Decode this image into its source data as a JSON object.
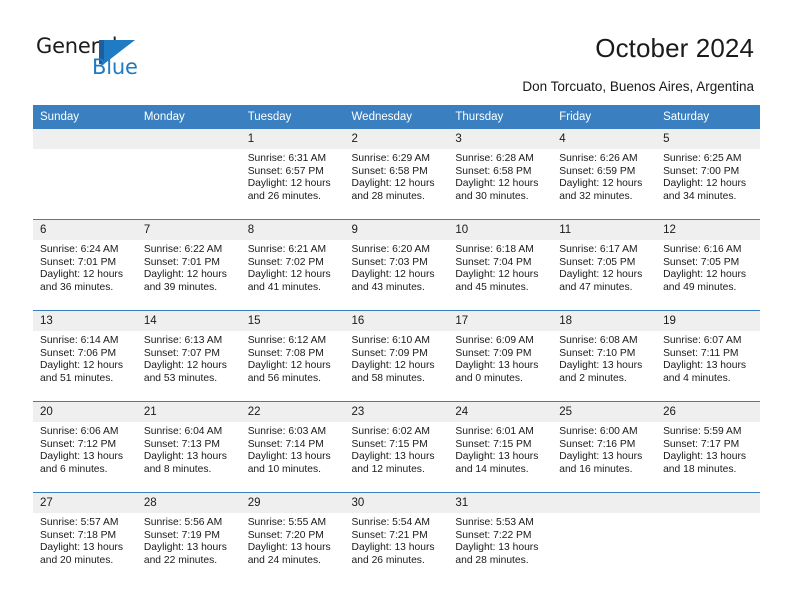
{
  "brand": {
    "name_part1": "General",
    "name_part2": "Blue",
    "logo_icon": "general-blue-flag-logo",
    "color_dark": "#1d5f9e",
    "color_light": "#1e7bc4"
  },
  "header": {
    "title": "October 2024",
    "subtitle": "Don Torcuato, Buenos Aires, Argentina"
  },
  "calendar": {
    "header_bg": "#3a7fbf",
    "daynum_bg": "#efefef",
    "weekdays": [
      "Sunday",
      "Monday",
      "Tuesday",
      "Wednesday",
      "Thursday",
      "Friday",
      "Saturday"
    ],
    "weeks": [
      [
        {
          "day": "",
          "sunrise": "",
          "sunset": "",
          "daylight": ""
        },
        {
          "day": "",
          "sunrise": "",
          "sunset": "",
          "daylight": ""
        },
        {
          "day": "1",
          "sunrise": "Sunrise: 6:31 AM",
          "sunset": "Sunset: 6:57 PM",
          "daylight": "Daylight: 12 hours and 26 minutes."
        },
        {
          "day": "2",
          "sunrise": "Sunrise: 6:29 AM",
          "sunset": "Sunset: 6:58 PM",
          "daylight": "Daylight: 12 hours and 28 minutes."
        },
        {
          "day": "3",
          "sunrise": "Sunrise: 6:28 AM",
          "sunset": "Sunset: 6:58 PM",
          "daylight": "Daylight: 12 hours and 30 minutes."
        },
        {
          "day": "4",
          "sunrise": "Sunrise: 6:26 AM",
          "sunset": "Sunset: 6:59 PM",
          "daylight": "Daylight: 12 hours and 32 minutes."
        },
        {
          "day": "5",
          "sunrise": "Sunrise: 6:25 AM",
          "sunset": "Sunset: 7:00 PM",
          "daylight": "Daylight: 12 hours and 34 minutes."
        }
      ],
      [
        {
          "day": "6",
          "sunrise": "Sunrise: 6:24 AM",
          "sunset": "Sunset: 7:01 PM",
          "daylight": "Daylight: 12 hours and 36 minutes."
        },
        {
          "day": "7",
          "sunrise": "Sunrise: 6:22 AM",
          "sunset": "Sunset: 7:01 PM",
          "daylight": "Daylight: 12 hours and 39 minutes."
        },
        {
          "day": "8",
          "sunrise": "Sunrise: 6:21 AM",
          "sunset": "Sunset: 7:02 PM",
          "daylight": "Daylight: 12 hours and 41 minutes."
        },
        {
          "day": "9",
          "sunrise": "Sunrise: 6:20 AM",
          "sunset": "Sunset: 7:03 PM",
          "daylight": "Daylight: 12 hours and 43 minutes."
        },
        {
          "day": "10",
          "sunrise": "Sunrise: 6:18 AM",
          "sunset": "Sunset: 7:04 PM",
          "daylight": "Daylight: 12 hours and 45 minutes."
        },
        {
          "day": "11",
          "sunrise": "Sunrise: 6:17 AM",
          "sunset": "Sunset: 7:05 PM",
          "daylight": "Daylight: 12 hours and 47 minutes."
        },
        {
          "day": "12",
          "sunrise": "Sunrise: 6:16 AM",
          "sunset": "Sunset: 7:05 PM",
          "daylight": "Daylight: 12 hours and 49 minutes."
        }
      ],
      [
        {
          "day": "13",
          "sunrise": "Sunrise: 6:14 AM",
          "sunset": "Sunset: 7:06 PM",
          "daylight": "Daylight: 12 hours and 51 minutes."
        },
        {
          "day": "14",
          "sunrise": "Sunrise: 6:13 AM",
          "sunset": "Sunset: 7:07 PM",
          "daylight": "Daylight: 12 hours and 53 minutes."
        },
        {
          "day": "15",
          "sunrise": "Sunrise: 6:12 AM",
          "sunset": "Sunset: 7:08 PM",
          "daylight": "Daylight: 12 hours and 56 minutes."
        },
        {
          "day": "16",
          "sunrise": "Sunrise: 6:10 AM",
          "sunset": "Sunset: 7:09 PM",
          "daylight": "Daylight: 12 hours and 58 minutes."
        },
        {
          "day": "17",
          "sunrise": "Sunrise: 6:09 AM",
          "sunset": "Sunset: 7:09 PM",
          "daylight": "Daylight: 13 hours and 0 minutes."
        },
        {
          "day": "18",
          "sunrise": "Sunrise: 6:08 AM",
          "sunset": "Sunset: 7:10 PM",
          "daylight": "Daylight: 13 hours and 2 minutes."
        },
        {
          "day": "19",
          "sunrise": "Sunrise: 6:07 AM",
          "sunset": "Sunset: 7:11 PM",
          "daylight": "Daylight: 13 hours and 4 minutes."
        }
      ],
      [
        {
          "day": "20",
          "sunrise": "Sunrise: 6:06 AM",
          "sunset": "Sunset: 7:12 PM",
          "daylight": "Daylight: 13 hours and 6 minutes."
        },
        {
          "day": "21",
          "sunrise": "Sunrise: 6:04 AM",
          "sunset": "Sunset: 7:13 PM",
          "daylight": "Daylight: 13 hours and 8 minutes."
        },
        {
          "day": "22",
          "sunrise": "Sunrise: 6:03 AM",
          "sunset": "Sunset: 7:14 PM",
          "daylight": "Daylight: 13 hours and 10 minutes."
        },
        {
          "day": "23",
          "sunrise": "Sunrise: 6:02 AM",
          "sunset": "Sunset: 7:15 PM",
          "daylight": "Daylight: 13 hours and 12 minutes."
        },
        {
          "day": "24",
          "sunrise": "Sunrise: 6:01 AM",
          "sunset": "Sunset: 7:15 PM",
          "daylight": "Daylight: 13 hours and 14 minutes."
        },
        {
          "day": "25",
          "sunrise": "Sunrise: 6:00 AM",
          "sunset": "Sunset: 7:16 PM",
          "daylight": "Daylight: 13 hours and 16 minutes."
        },
        {
          "day": "26",
          "sunrise": "Sunrise: 5:59 AM",
          "sunset": "Sunset: 7:17 PM",
          "daylight": "Daylight: 13 hours and 18 minutes."
        }
      ],
      [
        {
          "day": "27",
          "sunrise": "Sunrise: 5:57 AM",
          "sunset": "Sunset: 7:18 PM",
          "daylight": "Daylight: 13 hours and 20 minutes."
        },
        {
          "day": "28",
          "sunrise": "Sunrise: 5:56 AM",
          "sunset": "Sunset: 7:19 PM",
          "daylight": "Daylight: 13 hours and 22 minutes."
        },
        {
          "day": "29",
          "sunrise": "Sunrise: 5:55 AM",
          "sunset": "Sunset: 7:20 PM",
          "daylight": "Daylight: 13 hours and 24 minutes."
        },
        {
          "day": "30",
          "sunrise": "Sunrise: 5:54 AM",
          "sunset": "Sunset: 7:21 PM",
          "daylight": "Daylight: 13 hours and 26 minutes."
        },
        {
          "day": "31",
          "sunrise": "Sunrise: 5:53 AM",
          "sunset": "Sunset: 7:22 PM",
          "daylight": "Daylight: 13 hours and 28 minutes."
        },
        {
          "day": "",
          "sunrise": "",
          "sunset": "",
          "daylight": ""
        },
        {
          "day": "",
          "sunrise": "",
          "sunset": "",
          "daylight": ""
        }
      ]
    ]
  }
}
